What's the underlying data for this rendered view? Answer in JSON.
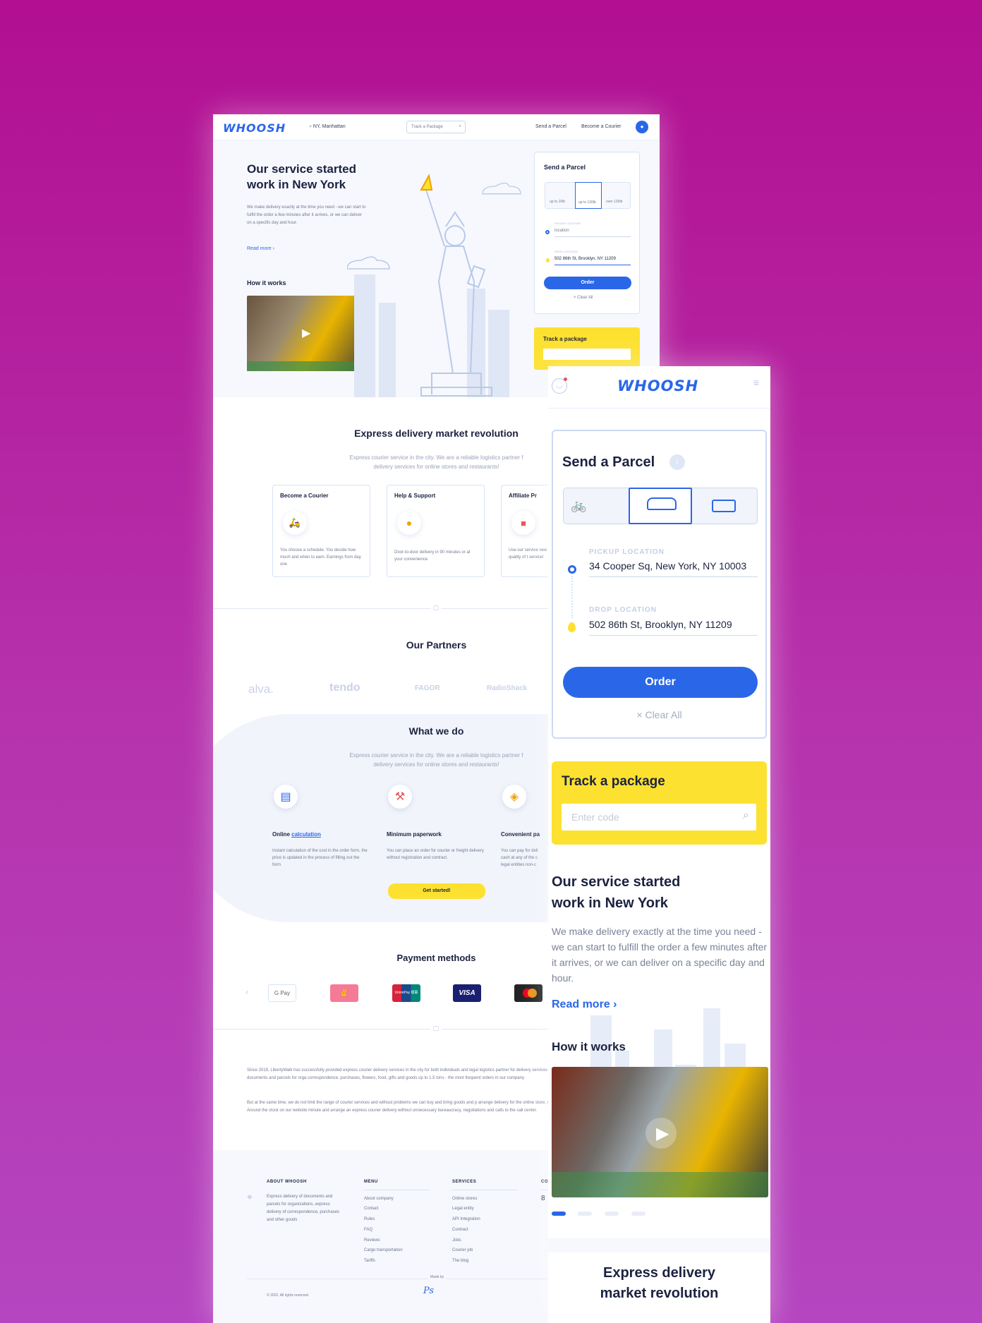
{
  "desktop": {
    "logo": "WHOOSH",
    "location": "NY, Manhattan",
    "track_placeholder": "Track a Package",
    "nav": [
      "Send a Parcel",
      "Become a Courier"
    ],
    "hero": {
      "title_1": "Our service started",
      "title_2": "work in New York",
      "text": "We make delivery exactly at the time you need - we can start to fulfill the order a few minutes after it arrives, or we can deliver on a specific day and hour.",
      "read_more": "Read more ›",
      "how": "How it works"
    },
    "send": {
      "title": "Send a Parcel",
      "vehicles": [
        "up to 10lb",
        "up to 130lb",
        "over 130lb"
      ],
      "pickup_label": "PICKUP LOCATION",
      "pickup_value": "location",
      "drop_label": "DROP LOCATION",
      "drop_value": "502 86th St, Brooklyn, NY 11209",
      "order": "Order",
      "clear": "× Clear All"
    },
    "track": {
      "title": "Track a package"
    },
    "express": {
      "title": "Express delivery market revolution",
      "sub_1": "Express courier service in the city. We are a reliable logistics partner f",
      "sub_2": "delivery services for online stores and restaurants!",
      "cards": [
        {
          "title": "Become a Courier",
          "text": "You choose a schedule. You decide how much and when to earn. Earnings from day one"
        },
        {
          "title": "Help & Support",
          "text": "Door-to-door delivery in 90 minutes or at your convenience"
        },
        {
          "title": "Affiliate Pr",
          "text": "Use our service new quality of t service!"
        }
      ]
    },
    "partners": {
      "title": "Our Partners",
      "items": [
        "alva.",
        "tendo",
        "FAGOR",
        "RadioShack"
      ]
    },
    "what": {
      "title": "What we do",
      "sub_1": "Express courier service in the city. We are a reliable logistics partner f",
      "sub_2": "delivery services for online stores and restaurants!",
      "items": [
        {
          "title_a": "Online ",
          "title_b": "calculation",
          "text": "Instant calculation of the cost in the order form, the price is updated in the process of filling out the form"
        },
        {
          "title_a": "Minimum paperwork",
          "title_b": "",
          "text": "You can place an order for courier or freight delivery without registration and contract."
        },
        {
          "title_a": "Convenient pa",
          "title_b": "",
          "text": "You can pay for deli cash at any of the c legal entities non-c"
        }
      ],
      "cta": "Get started!"
    },
    "payment": {
      "title": "Payment methods",
      "methods": [
        "G Pay",
        "✌",
        "UnionPay 银联",
        "VISA",
        "mastercard"
      ]
    },
    "about": {
      "p1": "Since 2019, LibertyWalk has successfully provided express courier delivery services in the city for both individuals and legal logistics partner for delivery services for online stores and restaurants! Express delivery of documents and parcels for orga correspondence, purchases, flowers, food, gifts and goods up to 1.5 tons - the most frequent orders in our company.",
      "p2": "But at the same time, we do not limit the range of courier services and without problems we can buy and bring goods and p arrange delivery for the online store, cafe, supermarket, restaurant or any other business. Around the clock on our website minute and arrange an express courier delivery without unnecessary bureaucracy, negotiations and calls to the call center."
    },
    "footer": {
      "about_head": "ABOUT WHOOSH",
      "about_text": "Express delivery of documents and parcels for organizations, express delivery of correspondence, purchases and other goods",
      "menu_head": "MENU",
      "menu": [
        "About company",
        "Contact",
        "Rules",
        "FAQ",
        "Reviews",
        "Cargo transportation",
        "Tariffs"
      ],
      "services_head": "SERVICES",
      "services": [
        "Online stores",
        "Legal entity",
        "API Integration",
        "Contract",
        "Jobs",
        "Courier job",
        "The blog"
      ],
      "co_head": "CO",
      "co_val": "8",
      "made_by": "Made by",
      "copyright": "© 2022. All rights reserved."
    }
  },
  "mobile": {
    "logo": "WHOOSH",
    "send": {
      "title": "Send a Parcel",
      "info": "i",
      "pickup_label": "PICKUP LOCATION",
      "pickup_value": "34 Cooper Sq, New York, NY 10003",
      "drop_label": "DROP LOCATION",
      "drop_value": "502 86th St, Brooklyn, NY 11209",
      "order": "Order",
      "clear": "× Clear All"
    },
    "track": {
      "title": "Track a package",
      "placeholder": "Enter code"
    },
    "hero": {
      "title_1": "Our service started",
      "title_2": "work in New York",
      "text": "We make delivery exactly at the time you need - we can start to fulfill the order a few minutes after it arrives, or we can deliver on a specific day and hour.",
      "read_more": "Read more ›",
      "how": "How it works"
    },
    "express_1": "Express delivery",
    "express_2": "market revolution"
  },
  "colors": {
    "accent": "#2a67e8",
    "yellow": "#fde130",
    "bg_magenta": "#b20f91",
    "ink": "#1b2240"
  }
}
